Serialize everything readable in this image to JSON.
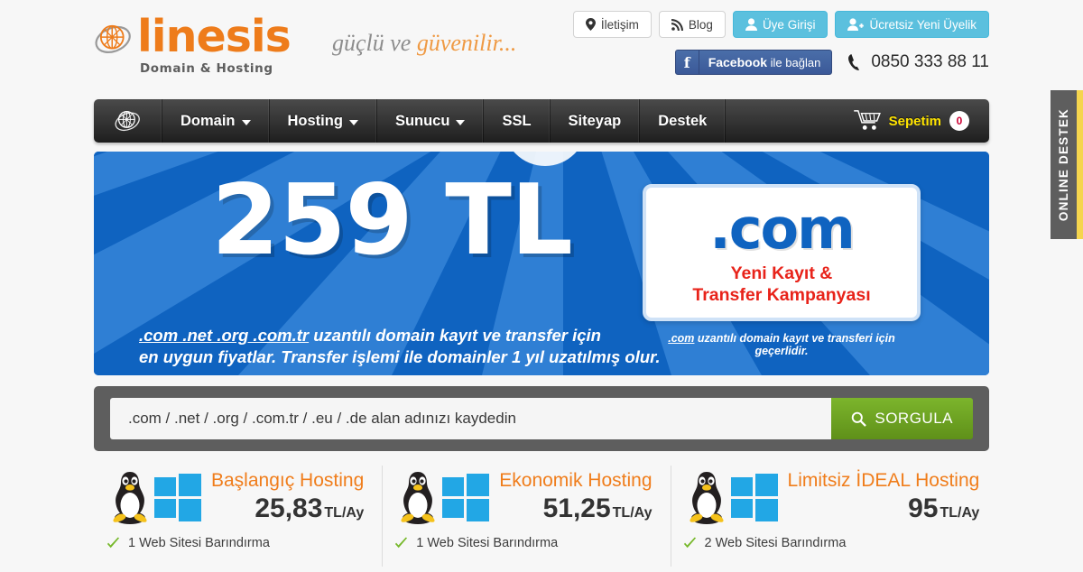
{
  "brand": {
    "name": "linesis",
    "subtitle": "Domain & Hosting",
    "globe_icon": "globe-icon"
  },
  "tagline": {
    "plain": "güçlü ve ",
    "accent": "güvenilir..."
  },
  "topbar": {
    "buttons": [
      {
        "label": "İletişim",
        "icon": "location-pin-icon",
        "style": "light"
      },
      {
        "label": "Blog",
        "icon": "rss-icon",
        "style": "light"
      },
      {
        "label": "Üye Girişi",
        "icon": "user-icon",
        "style": "cyan"
      },
      {
        "label": "Ücretsiz Yeni Üyelik",
        "icon": "user-plus-icon",
        "style": "cyan"
      }
    ],
    "facebook": {
      "bold": "Facebook",
      "rest": " ile bağlan",
      "icon": "facebook-icon"
    },
    "phone": {
      "number": "0850 333 88 11",
      "icon": "phone-icon"
    }
  },
  "nav": {
    "home_icon": "globe-icon",
    "items": [
      {
        "label": "Domain",
        "has_dropdown": true
      },
      {
        "label": "Hosting",
        "has_dropdown": true
      },
      {
        "label": "Sunucu",
        "has_dropdown": true
      },
      {
        "label": "SSL",
        "has_dropdown": false
      },
      {
        "label": "Siteyap",
        "has_dropdown": false
      },
      {
        "label": "Destek",
        "has_dropdown": false
      }
    ],
    "cart": {
      "label": "Sepetim",
      "count": "0",
      "icon": "shopping-cart-icon"
    }
  },
  "banner": {
    "price": "259 TL",
    "sub_line1_underlined": ".com .net .org .com.tr",
    "sub_line1_rest": " uzantılı domain kayıt ve transfer için",
    "sub_line2": "en uygun fiyatlar. Transfer işlemi ile domainler 1 yıl uzatılmış olur.",
    "card": {
      "tld": ".com",
      "red_line1": "Yeni Kayıt &",
      "red_line2": "Transfer Kampanyası"
    },
    "note_underlined": ".com",
    "note_rest": " uzantılı domain kayıt ve transferi için geçerlidir.",
    "colors": {
      "dark_blue": "#0f63c0",
      "light_blue": "#2f7fd4",
      "red": "#e8231a"
    }
  },
  "search": {
    "placeholder": ".com / .net / .org / .com.tr / .eu / .de alan adınızı kaydedin",
    "value": "",
    "button_label": "SORGULA",
    "button_icon": "search-icon",
    "button_color": "#6ea524"
  },
  "plans": [
    {
      "name": "Başlangıç Hosting",
      "price": "25,83",
      "unit": "TL/Ay",
      "feature": "1 Web Sitesi Barındırma",
      "os": [
        "linux-penguin-icon",
        "windows-icon"
      ]
    },
    {
      "name": "Ekonomik Hosting",
      "price": "51,25",
      "unit": "TL/Ay",
      "feature": "1 Web Sitesi Barındırma",
      "os": [
        "linux-penguin-icon",
        "windows-icon"
      ]
    },
    {
      "name": "Limitsiz İDEAL Hosting",
      "price": "95",
      "unit": "TL/Ay",
      "feature": "2 Web Sitesi Barındırma",
      "os": [
        "linux-penguin-icon",
        "windows-icon"
      ]
    }
  ],
  "side_tab": {
    "label": "ONLINE DESTEK",
    "accent_color": "#f5d54e"
  }
}
